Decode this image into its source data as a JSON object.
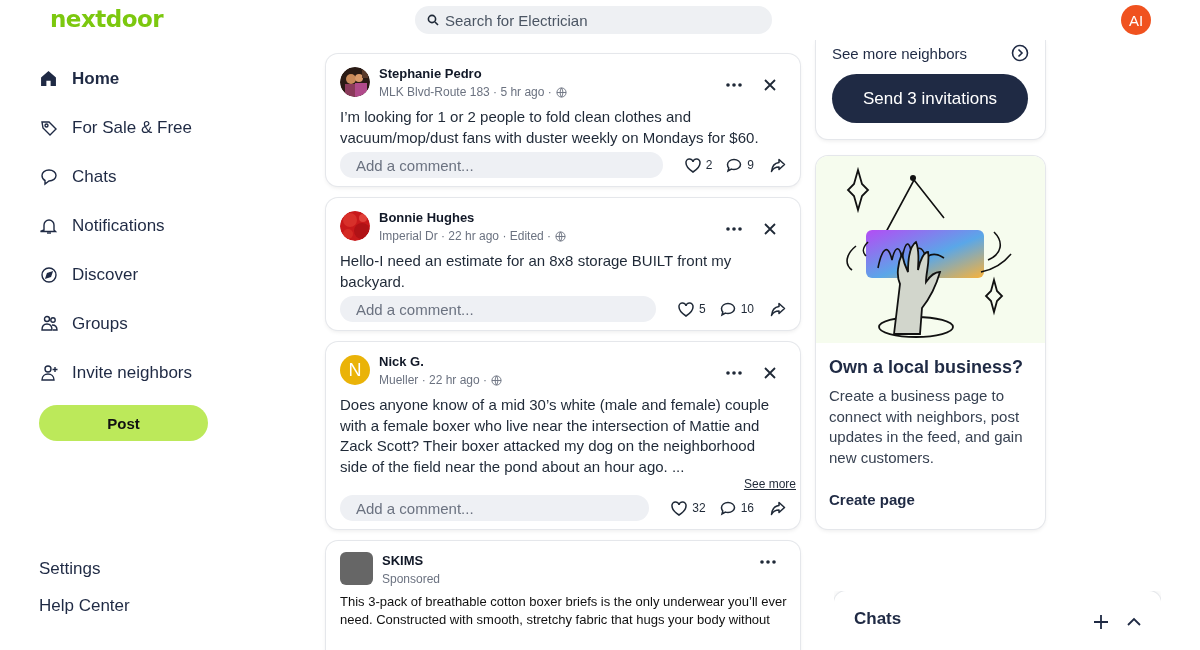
{
  "header": {
    "logo": "nextdoor",
    "search": {
      "placeholder": "Search for Electrician"
    },
    "avatar": "AI"
  },
  "sidebar": {
    "items": [
      {
        "label": "Home",
        "selected": true
      },
      {
        "label": "For Sale & Free",
        "selected": false
      },
      {
        "label": "Chats",
        "selected": false
      },
      {
        "label": "Notifications",
        "selected": false
      },
      {
        "label": "Discover",
        "selected": false
      },
      {
        "label": "Groups",
        "selected": false
      },
      {
        "label": "Invite neighbors",
        "selected": false
      }
    ],
    "post_button": "Post",
    "footer_links": [
      "Settings",
      "Help Center"
    ]
  },
  "feed": {
    "posts": [
      {
        "kind": "post",
        "author": "Stephanie Pedro",
        "meta": "MLK Blvd-Route 183 · 5 hr ago ·",
        "body": "I’m looking for 1 or 2 people to fold clean clothes and vacuum/mop/dust fans with duster weekly on Mondays for $60.",
        "comment_placeholder": "Add a comment...",
        "likes": "2",
        "comments": "9"
      },
      {
        "kind": "post",
        "author": "Bonnie Hughes",
        "meta": "Imperial Dr · 22 hr ago · Edited ·",
        "body": "Hello-I need an estimate for an 8x8 storage BUILT front my backyard.",
        "comment_placeholder": "Add a comment...",
        "likes": "5",
        "comments": "10"
      },
      {
        "kind": "post",
        "author": "Nick G.",
        "avatar": {
          "kind": "initial",
          "text": "N",
          "color": "#eab308"
        },
        "meta": "Mueller · 22 hr ago ·",
        "body": "Does anyone know of a mid 30’s white (male and female) couple with a female boxer who live near the intersection of Mattie and Zack Scott? Their boxer attacked my dog on the neighborhood side of the field near the pond about an hour ago.  ...",
        "see_more": "See more",
        "comment_placeholder": "Add a comment...",
        "likes": "32",
        "comments": "16"
      },
      {
        "kind": "ad",
        "author": "SKIMS",
        "meta": "Sponsored",
        "body": "This 3-pack of breathable cotton boxer briefs is the only underwear you’ll ever need. Constructed with smooth, stretchy fabric that hugs your body without"
      }
    ]
  },
  "invite": {
    "see_more": "See more neighbors",
    "button": "Send 3 invitations"
  },
  "business": {
    "title": "Own a local business?",
    "body": "Create a business page to connect with neighbors, post updates in the feed, and gain new customers.",
    "link": "Create page"
  },
  "chats_panel": {
    "title": "Chats"
  }
}
